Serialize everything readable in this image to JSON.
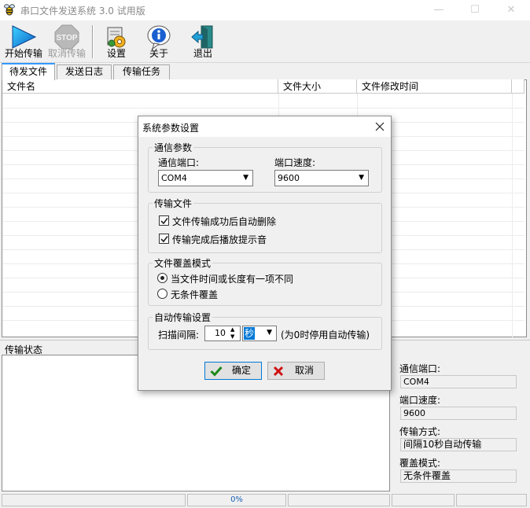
{
  "window": {
    "title": "串口文件发送系统 3.0 试用版",
    "controls": {
      "minimize": "—",
      "maximize": "☐",
      "close": "✕"
    }
  },
  "toolbar": {
    "start_label": "开始传输",
    "stop_icon_text": "STOP",
    "cancel_label": "取消传输",
    "settings_label": "设置",
    "about_label": "关于",
    "exit_label": "退出"
  },
  "tabs": [
    "待发文件",
    "发送日志",
    "传输任务"
  ],
  "file_table": {
    "columns": [
      "文件名",
      "文件大小",
      "文件修改时间"
    ]
  },
  "status_panel": {
    "label": "传输状态",
    "port_label": "通信端口:",
    "port_value": "COM4",
    "speed_label": "端口速度:",
    "speed_value": "9600",
    "mode_label": "传输方式:",
    "mode_value": "间隔10秒自动传输",
    "overwrite_label": "覆盖模式:",
    "overwrite_value": "无条件覆盖"
  },
  "statusbar": {
    "progress": "0%"
  },
  "dialog": {
    "title": "系统参数设置",
    "comm_group": "通信参数",
    "port_label": "通信端口:",
    "port_value": "COM4",
    "speed_label": "端口速度:",
    "speed_value": "9600",
    "file_group": "传输文件",
    "auto_delete_label": "文件传输成功后自动删除",
    "auto_delete_checked": true,
    "play_sound_label": "传输完成后播放提示音",
    "play_sound_checked": true,
    "overwrite_group": "文件覆盖模式",
    "overwrite_opt1": "当文件时间或长度有一项不同",
    "overwrite_opt2": "无条件覆盖",
    "overwrite_selected": 1,
    "auto_group": "自动传输设置",
    "interval_label": "扫描间隔:",
    "interval_value": "10",
    "interval_unit": "秒",
    "interval_hint": "(为0时停用自动传输)",
    "ok_label": "确定",
    "cancel_label": "取消"
  },
  "colors": {
    "accent_blue": "#0078d7",
    "tab_highlight": "#3399ff",
    "ok_check": "#1a8a1a",
    "cancel_x": "#d01010"
  }
}
